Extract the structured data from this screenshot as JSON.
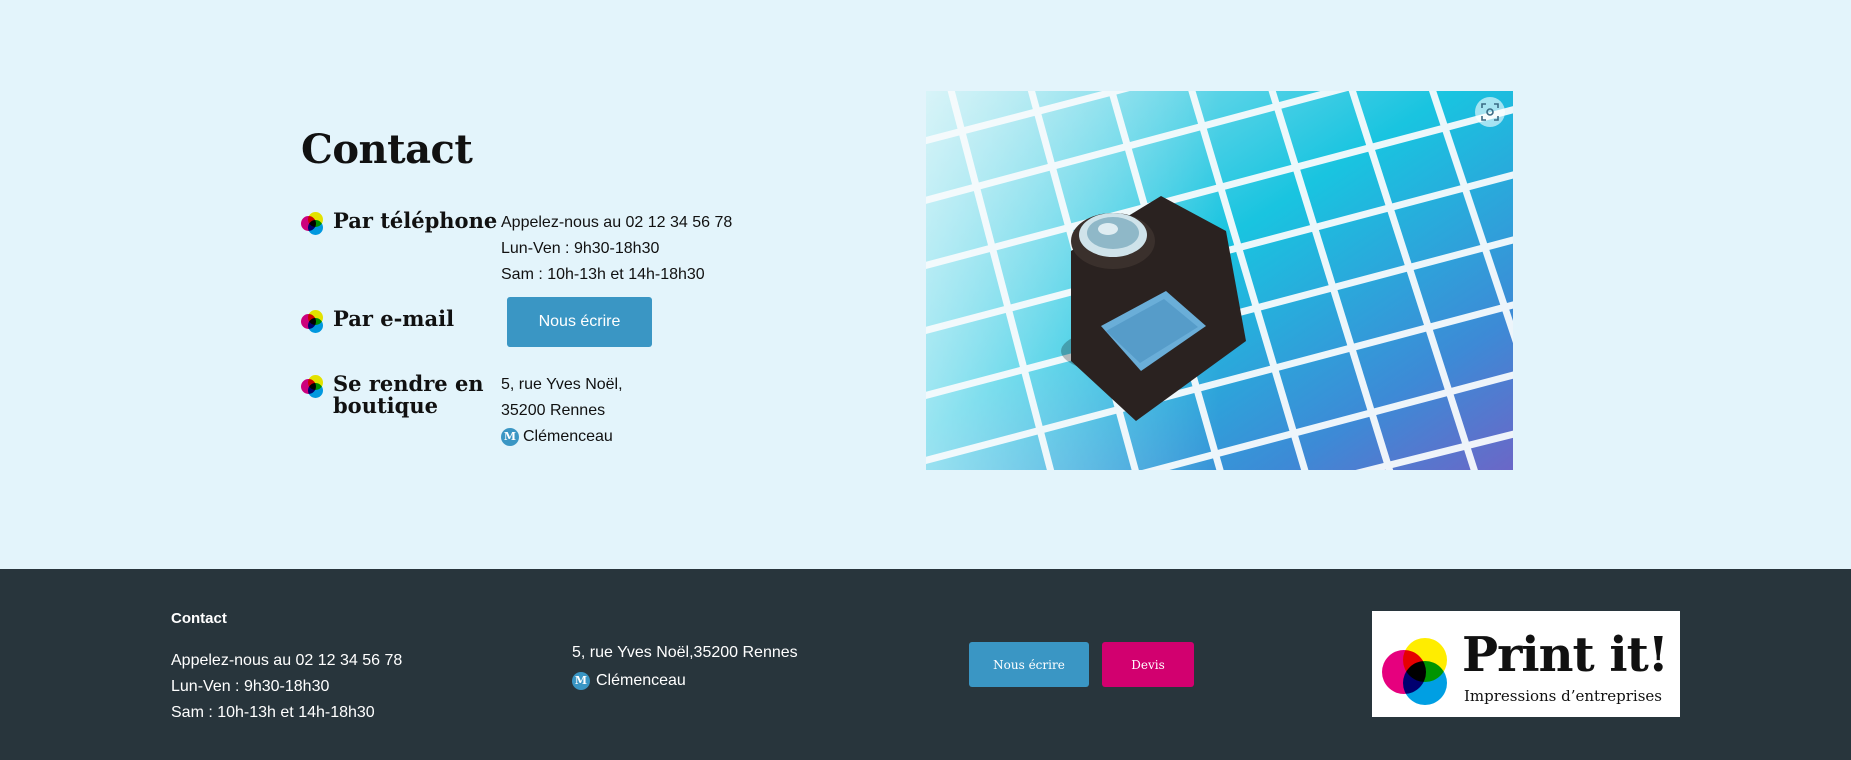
{
  "contact": {
    "title": "Contact",
    "phone": {
      "label": "Par téléphone",
      "lines": [
        "Appelez-nous au 02 12 34 56 78",
        "Lun-Ven : 9h30-18h30",
        "Sam : 10h-13h et 14h-18h30"
      ]
    },
    "email": {
      "label": "Par e-mail",
      "button": "Nous écrire"
    },
    "shop": {
      "label_line1": "Se rendre en",
      "label_line2": "boutique",
      "address1": "5, rue Yves Noël,",
      "address2": "35200 Rennes",
      "metro_icon": "M",
      "metro": "Clémenceau"
    },
    "image": {
      "description_icon": "loupe-on-color-chart-image",
      "zoom_icon": "zoom-scan-icon"
    }
  },
  "footer": {
    "title": "Contact",
    "phone": "Appelez-nous au 02 12 34 56 78",
    "weekdays": "Lun-Ven : 9h30-18h30",
    "saturday": "Sam : 10h-13h et 14h-18h30",
    "address": "5, rue Yves Noël,35200 Rennes",
    "metro_icon": "M",
    "metro": "Clémenceau",
    "write_button": "Nous écrire",
    "quote_button": "Devis",
    "logo": {
      "name": "Print it!",
      "tagline": "Impressions d’entreprises"
    }
  },
  "colors": {
    "background": "#e3f4fb",
    "accent_blue": "#3a96c4",
    "accent_magenta": "#d2006f",
    "footer_bg": "#28353c"
  }
}
